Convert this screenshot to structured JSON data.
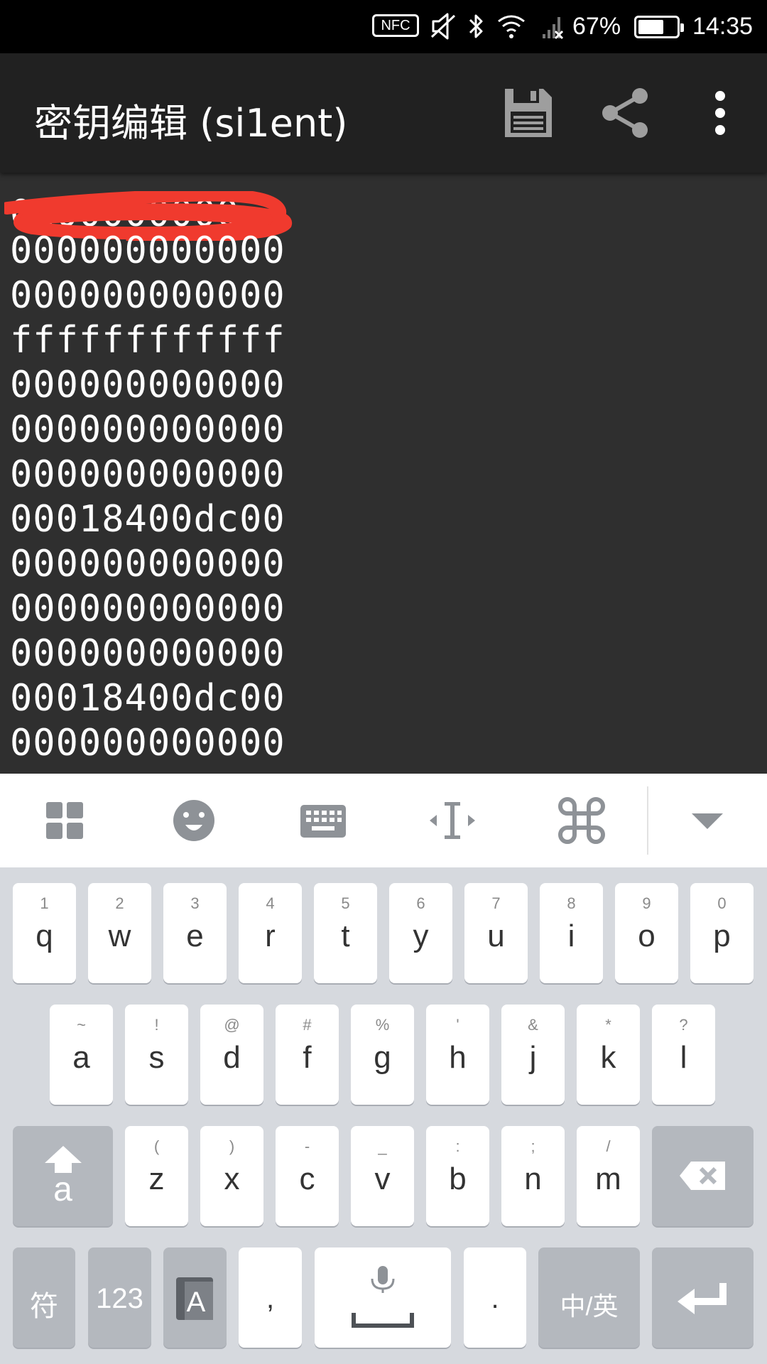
{
  "status_bar": {
    "nfc": "NFC",
    "battery_percent": "67%",
    "battery_level": 0.67,
    "time": "14:35",
    "icons": [
      "nfc-icon",
      "mute-icon",
      "bluetooth-icon",
      "wifi-icon",
      "no-signal-icon",
      "battery-icon"
    ]
  },
  "app_bar": {
    "title": "密钥编辑 (si1ent)",
    "actions": [
      "save-icon",
      "share-icon",
      "more-vert-icon"
    ]
  },
  "editor": {
    "redacted_first_line": true,
    "lines": [
      "000000000000",
      "000000000000",
      "ffffffffffff",
      "000000000000",
      "000000000000",
      "000000000000",
      "00018400dc00",
      "000000000000",
      "000000000000",
      "000000000000",
      "00018400dc00",
      "000000000000"
    ]
  },
  "keyboard_toolbar": {
    "buttons": [
      "grid-icon",
      "emoji-icon",
      "keyboard-icon",
      "cursor-move-icon",
      "command-icon",
      "collapse-icon"
    ]
  },
  "keyboard": {
    "row1": [
      {
        "hint": "1",
        "key": "q"
      },
      {
        "hint": "2",
        "key": "w"
      },
      {
        "hint": "3",
        "key": "e"
      },
      {
        "hint": "4",
        "key": "r"
      },
      {
        "hint": "5",
        "key": "t"
      },
      {
        "hint": "6",
        "key": "y"
      },
      {
        "hint": "7",
        "key": "u"
      },
      {
        "hint": "8",
        "key": "i"
      },
      {
        "hint": "9",
        "key": "o"
      },
      {
        "hint": "0",
        "key": "p"
      }
    ],
    "row2": [
      {
        "hint": "~",
        "key": "a"
      },
      {
        "hint": "!",
        "key": "s"
      },
      {
        "hint": "@",
        "key": "d"
      },
      {
        "hint": "#",
        "key": "f"
      },
      {
        "hint": "%",
        "key": "g"
      },
      {
        "hint": "'",
        "key": "h"
      },
      {
        "hint": "&",
        "key": "j"
      },
      {
        "hint": "*",
        "key": "k"
      },
      {
        "hint": "?",
        "key": "l"
      }
    ],
    "row3": [
      {
        "hint": "(",
        "key": "z"
      },
      {
        "hint": ")",
        "key": "x"
      },
      {
        "hint": "-",
        "key": "c"
      },
      {
        "hint": "_",
        "key": "v"
      },
      {
        "hint": ":",
        "key": "b"
      },
      {
        "hint": ";",
        "key": "n"
      },
      {
        "hint": "/",
        "key": "m"
      }
    ],
    "shift_label": "a",
    "symbols_label": "符",
    "numbers_label": "123",
    "comma_label": ",",
    "period_label": ".",
    "language_label": "中/英"
  }
}
